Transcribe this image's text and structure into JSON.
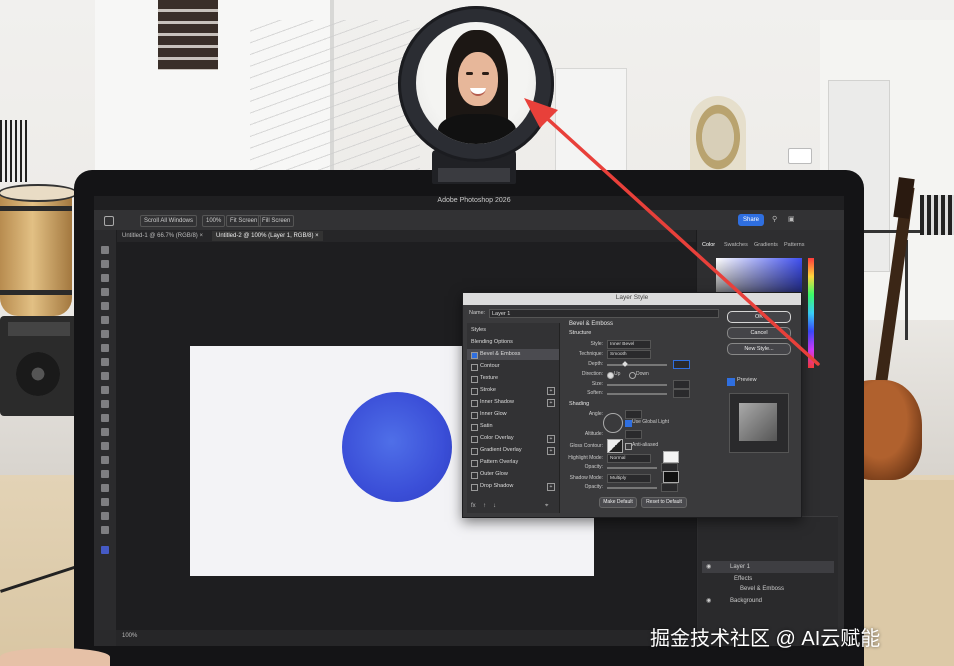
{
  "photoshop": {
    "app_title": "Adobe Photoshop 2026",
    "options": {
      "scroll_all_windows": "Scroll All Windows",
      "zoom_100": "100%",
      "fit_screen": "Fit Screen",
      "fill_screen": "Fill Screen"
    },
    "share_label": "Share",
    "document_tabs": [
      {
        "label": "Untitled-1 @ 66.7% (RGB/8) ×"
      },
      {
        "label": "Untitled-2 @ 100% (Layer 1, RGB/8) ×"
      }
    ],
    "panel_tabs": [
      "Color",
      "Swatches",
      "Gradients",
      "Patterns"
    ],
    "layers": [
      {
        "label": "Layer 1"
      },
      {
        "label": "Effects"
      },
      {
        "label": "Bevel & Emboss"
      },
      {
        "label": "Background"
      }
    ],
    "status": {
      "zoom": "100%"
    },
    "canvas_circle_color": "#3b4fd8"
  },
  "layer_style": {
    "title": "Layer Style",
    "name_label": "Name:",
    "name_value": "Layer 1",
    "styles": [
      {
        "label": "Styles",
        "checkbox": false,
        "plus": false,
        "selected": false
      },
      {
        "label": "Blending Options",
        "checkbox": false,
        "plus": false,
        "selected": false
      },
      {
        "label": "Bevel & Emboss",
        "checkbox": true,
        "plus": false,
        "selected": true
      },
      {
        "label": "Contour",
        "checkbox": true,
        "plus": false,
        "selected": false
      },
      {
        "label": "Texture",
        "checkbox": true,
        "plus": false,
        "selected": false
      },
      {
        "label": "Stroke",
        "checkbox": true,
        "plus": true,
        "selected": false
      },
      {
        "label": "Inner Shadow",
        "checkbox": true,
        "plus": true,
        "selected": false
      },
      {
        "label": "Inner Glow",
        "checkbox": true,
        "plus": false,
        "selected": false
      },
      {
        "label": "Satin",
        "checkbox": true,
        "plus": false,
        "selected": false
      },
      {
        "label": "Color Overlay",
        "checkbox": true,
        "plus": true,
        "selected": false
      },
      {
        "label": "Gradient Overlay",
        "checkbox": true,
        "plus": true,
        "selected": false
      },
      {
        "label": "Pattern Overlay",
        "checkbox": true,
        "plus": false,
        "selected": false
      },
      {
        "label": "Outer Glow",
        "checkbox": true,
        "plus": false,
        "selected": false
      },
      {
        "label": "Drop Shadow",
        "checkbox": true,
        "plus": true,
        "selected": false
      }
    ],
    "bevel": {
      "heading": "Bevel & Emboss",
      "structure_heading": "Structure",
      "style_label": "Style:",
      "style_value": "Inner Bevel",
      "technique_label": "Technique:",
      "technique_value": "Smooth",
      "depth_label": "Depth:",
      "direction_label": "Direction:",
      "direction_up": "Up",
      "direction_down": "Down",
      "size_label": "Size:",
      "soften_label": "Soften:",
      "shading_heading": "Shading",
      "angle_label": "Angle:",
      "global_light_label": "Use Global Light",
      "altitude_label": "Altitude:",
      "gloss_label": "Gloss Contour:",
      "antialiased_label": "Anti-aliased",
      "highlight_label": "Highlight Mode:",
      "highlight_value": "Normal",
      "opacity_label": "Opacity:",
      "shadow_label": "Shadow Mode:",
      "shadow_value": "Multiply",
      "opacity2_label": "Opacity:",
      "make_default": "Make Default",
      "reset_default": "Reset to Default"
    },
    "buttons": {
      "ok": "OK",
      "cancel": "Cancel",
      "new_style": "New Style...",
      "preview": "Preview"
    },
    "bottom_icons": [
      "fx",
      "↑",
      "↓",
      "⌖"
    ]
  },
  "watermark": "掘金技术社区 @ AI云赋能",
  "annotation_arrow_color": "#e8403a"
}
